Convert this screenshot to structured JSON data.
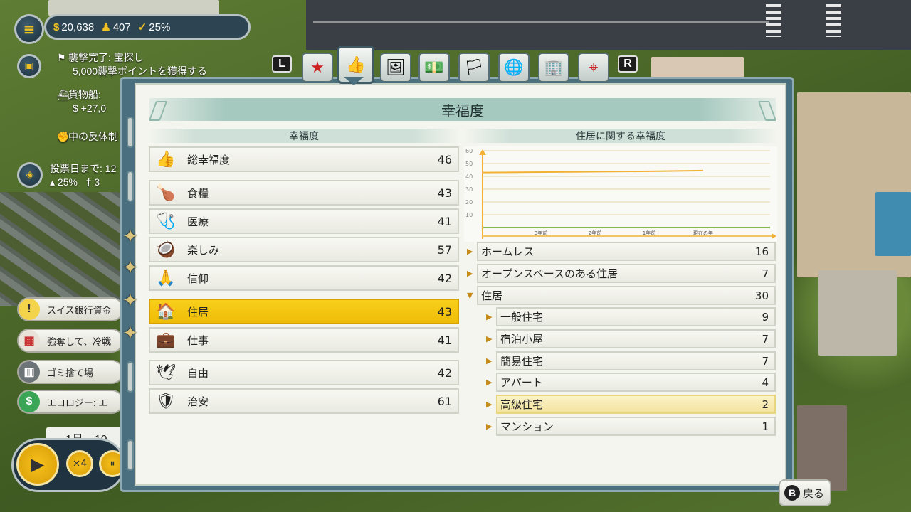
{
  "hud": {
    "money": "20,638",
    "population": "407",
    "approval": "25%",
    "icons": {
      "menu": "menu-icon",
      "money": "dollar-icon",
      "pop": "person-icon",
      "approval": "thumbs-up-icon"
    }
  },
  "notifications": [
    {
      "icon": "flag-icon",
      "line1": "襲撃完了: 宝探し",
      "line2": "5,000襲撃ポイントを獲得する"
    },
    {
      "icon": "ship-icon",
      "line1": "貨物船:",
      "line2": "$ +27,0"
    },
    {
      "icon": "fist-icon",
      "line1": "中の反体制",
      "line2": ""
    }
  ],
  "election": {
    "label": "投票日まで: 12",
    "stat1": "25%",
    "stat2": "3"
  },
  "side_pills": [
    {
      "icon": "exclamation-icon",
      "label": "スイス銀行資金"
    },
    {
      "icon": "calendar-icon",
      "label": "強奪して、冷戦"
    },
    {
      "icon": "trash-icon",
      "label": "ゴミ捨て場"
    },
    {
      "icon": "dollar-icon",
      "label": "エコロジー: エ"
    }
  ],
  "time": {
    "date": "1月、19",
    "speed_label": "×4"
  },
  "tabs": {
    "left_button": "L",
    "right_button": "R",
    "items": [
      {
        "name": "tab-politics",
        "icon": "star-badge-icon"
      },
      {
        "name": "tab-happiness",
        "icon": "thumbs-up-icon",
        "active": true
      },
      {
        "name": "tab-people",
        "icon": "portrait-icon"
      },
      {
        "name": "tab-economy",
        "icon": "money-stack-icon"
      },
      {
        "name": "tab-factions",
        "icon": "flag-icon"
      },
      {
        "name": "tab-world",
        "icon": "globe-icon"
      },
      {
        "name": "tab-buildings",
        "icon": "building-icon"
      },
      {
        "name": "tab-military",
        "icon": "crosshair-icon"
      }
    ]
  },
  "panel": {
    "title": "幸福度",
    "left_header": "幸福度",
    "right_header": "住居に関する幸福度",
    "categories": [
      {
        "label": "総幸福度",
        "value": "46",
        "icon": "thumbs-up-icon",
        "emoji": "👍"
      },
      {
        "label": "食糧",
        "value": "43",
        "icon": "roast-chicken-icon",
        "emoji": "🍗"
      },
      {
        "label": "医療",
        "value": "41",
        "icon": "stethoscope-icon",
        "emoji": "🩺"
      },
      {
        "label": "楽しみ",
        "value": "57",
        "icon": "coconut-drink-icon",
        "emoji": "🥥"
      },
      {
        "label": "信仰",
        "value": "42",
        "icon": "praying-hands-icon",
        "emoji": "🙏"
      },
      {
        "label": "住居",
        "value": "43",
        "icon": "house-icon",
        "emoji": "🏠",
        "selected": true
      },
      {
        "label": "仕事",
        "value": "41",
        "icon": "briefcase-icon",
        "emoji": "💼"
      },
      {
        "label": "自由",
        "value": "42",
        "icon": "dove-icon",
        "emoji": "🕊"
      },
      {
        "label": "治安",
        "value": "61",
        "icon": "police-badge-icon",
        "emoji": "🛡"
      }
    ],
    "housing": [
      {
        "label": "ホームレス",
        "value": "16",
        "level": 0,
        "expanded": false
      },
      {
        "label": "オープンスペースのある住居",
        "value": "7",
        "level": 0,
        "expanded": false
      },
      {
        "label": "住居",
        "value": "30",
        "level": 0,
        "expanded": true
      },
      {
        "label": "一般住宅",
        "value": "9",
        "level": 1,
        "expanded": false
      },
      {
        "label": "宿泊小屋",
        "value": "7",
        "level": 1,
        "expanded": false
      },
      {
        "label": "簡易住宅",
        "value": "7",
        "level": 1,
        "expanded": false
      },
      {
        "label": "アパート",
        "value": "4",
        "level": 1,
        "expanded": false
      },
      {
        "label": "高級住宅",
        "value": "2",
        "level": 1,
        "expanded": false,
        "selected": true
      },
      {
        "label": "マンション",
        "value": "1",
        "level": 1,
        "expanded": false
      }
    ],
    "back_button": {
      "key": "B",
      "label": "戻る"
    }
  },
  "chart_data": {
    "type": "line",
    "y_ticks": [
      "10",
      "20",
      "30",
      "40",
      "50",
      "60"
    ],
    "x_ticks": [
      "3年前",
      "2年前",
      "1年前",
      "現在の年"
    ],
    "ylim": [
      0,
      60
    ],
    "series": [
      {
        "color": "#f2b134",
        "x": [
          0,
          0.4,
          0.8,
          1.0
        ],
        "values": [
          43,
          43.5,
          44,
          44.5
        ]
      }
    ],
    "accent_colors": {
      "axis": "#f2b134",
      "baseline": "#86b84a"
    }
  }
}
